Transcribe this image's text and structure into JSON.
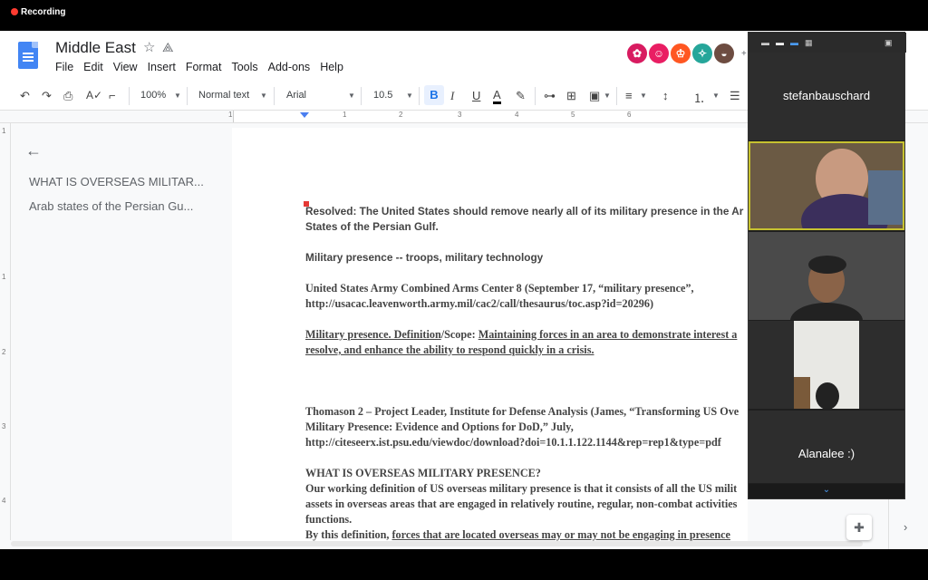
{
  "recording": {
    "label": "Recording"
  },
  "doc": {
    "title": "Middle East",
    "menu": [
      "File",
      "Edit",
      "View",
      "Insert",
      "Format",
      "Tools",
      "Add-ons",
      "Help"
    ],
    "avatars_more": "+",
    "colors": {
      "accent": "#4285f4",
      "avatar1": "#d81b60",
      "avatar2": "#e91e63",
      "avatar3": "#ff5722",
      "avatar4": "#26a69a",
      "avatar5": "#6d4c41"
    }
  },
  "toolbar": {
    "zoom": "100%",
    "style": "Normal text",
    "font": "Arial",
    "size": "10.5",
    "bold": "B",
    "italic": "I",
    "underline": "U",
    "text_color": "A"
  },
  "ruler": {
    "numbers": [
      "1",
      "1",
      "2",
      "3",
      "4",
      "5",
      "6"
    ]
  },
  "vruler": {
    "numbers": [
      "1",
      "1",
      "2",
      "3",
      "4"
    ]
  },
  "outline": {
    "items": [
      "WHAT IS OVERSEAS MILITAR...",
      "Arab states of the Persian Gu..."
    ]
  },
  "content": {
    "resolved_1": "Resolved: The United States should remove nearly all of its military presence in the Ar",
    "resolved_2": "States of the Persian Gulf.",
    "mp": "Military presence -- troops, military technology",
    "army_1": "United States Army Combined Arms Center 8 (September 17, “military presence”,",
    "army_2": "http://usacac.leavenworth.army.mil/cac2/call/thesaurus/toc.asp?id=20296)",
    "def_a": "Military presence. Definition",
    "def_b": "/Scope: ",
    "def_c": "Maintaining forces in an area to demonstrate interest a",
    "def_2": "resolve, and enhance the ability to respond quickly in a crisis.",
    "tho_1": "Thomason 2 – Project Leader, Institute for Defense Analysis (James, “Transforming US Ove",
    "tho_2": "Military Presence: Evidence and Options for DoD,” July,",
    "tho_3": "http://citeseerx.ist.psu.edu/viewdoc/download?doi=10.1.1.122.1144&rep=rep1&type=pdf",
    "what": "WHAT IS OVERSEAS MILITARY PRESENCE?",
    "work_1": "Our working definition of US overseas military presence is that it consists of all the US milit",
    "work_2": "assets in overseas areas that are engaged in relatively routine, regular, non-combat activities",
    "work_3": "functions.",
    "by_a": "By this definition, ",
    "by_b": "forces that are located overseas may or may not be engaging in presence"
  },
  "zoom": {
    "participants": [
      "stefanbauschard",
      "Alanalee :)"
    ]
  }
}
